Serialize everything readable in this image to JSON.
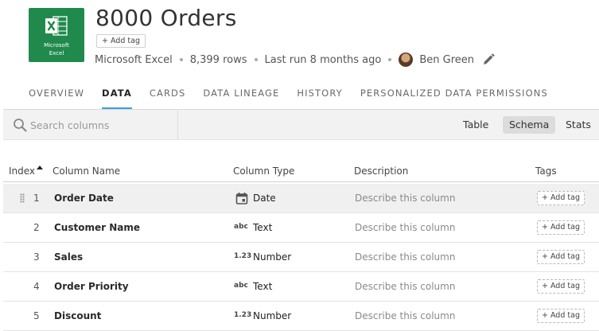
{
  "dataset": {
    "title": "8000 Orders",
    "add_tag_label": "+ Add tag",
    "source": "Microsoft Excel",
    "rows_text": "8,399 rows",
    "last_run": "Last run 8 months ago",
    "owner": "Ben Green"
  },
  "logo": {
    "line1": "Microsoft",
    "line2": "Excel",
    "color": "#1f8a4c"
  },
  "tabs": [
    {
      "label": "OVERVIEW",
      "active": false
    },
    {
      "label": "DATA",
      "active": true
    },
    {
      "label": "CARDS",
      "active": false
    },
    {
      "label": "DATA LINEAGE",
      "active": false
    },
    {
      "label": "HISTORY",
      "active": false
    },
    {
      "label": "PERSONALIZED DATA PERMISSIONS",
      "active": false
    }
  ],
  "toolbar": {
    "search_placeholder": "Search columns",
    "views": [
      {
        "label": "Table",
        "active": false
      },
      {
        "label": "Schema",
        "active": true
      },
      {
        "label": "Stats",
        "active": false
      }
    ]
  },
  "table": {
    "headers": {
      "index": "Index",
      "column_name": "Column Name",
      "column_type": "Column Type",
      "description": "Description",
      "tags": "Tags"
    },
    "rows": [
      {
        "index": "1",
        "name": "Order Date",
        "type_icon": "calendar-icon",
        "type_glyph": "",
        "type": "Date",
        "description": "Describe this column",
        "tag": "+ Add tag"
      },
      {
        "index": "2",
        "name": "Customer Name",
        "type_icon": "text-type-icon",
        "type_glyph": "abc",
        "type": "Text",
        "description": "Describe this column",
        "tag": "+ Add tag"
      },
      {
        "index": "3",
        "name": "Sales",
        "type_icon": "number-type-icon",
        "type_glyph": "1.23",
        "type": "Number",
        "description": "Describe this column",
        "tag": "+ Add tag"
      },
      {
        "index": "4",
        "name": "Order Priority",
        "type_icon": "text-type-icon",
        "type_glyph": "abc",
        "type": "Text",
        "description": "Describe this column",
        "tag": "+ Add tag"
      },
      {
        "index": "5",
        "name": "Discount",
        "type_icon": "number-type-icon",
        "type_glyph": "1.23",
        "type": "Number",
        "description": "Describe this column",
        "tag": "+ Add tag"
      }
    ]
  },
  "colors": {
    "accent": "#3ca0d8",
    "excel_green": "#1f8a4c"
  }
}
